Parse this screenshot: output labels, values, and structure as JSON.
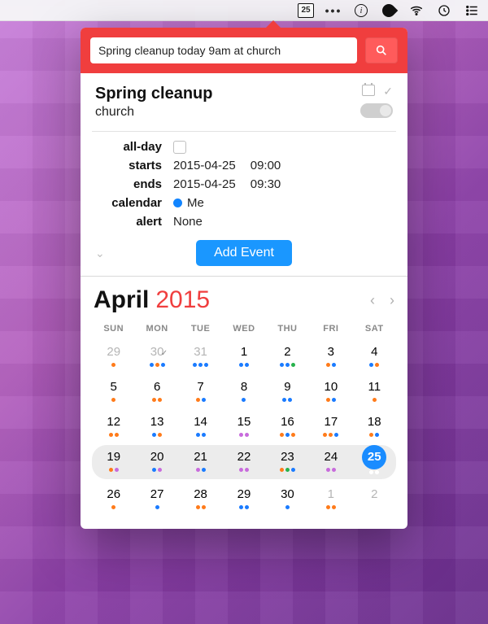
{
  "menubar": {
    "calendar_badge": "25"
  },
  "search": {
    "value": "Spring cleanup today 9am at church"
  },
  "event": {
    "title": "Spring cleanup",
    "location": "church",
    "labels": {
      "allday": "all-day",
      "starts": "starts",
      "ends": "ends",
      "calendar": "calendar",
      "alert": "alert"
    },
    "starts_date": "2015-04-25",
    "starts_time": "09:00",
    "ends_date": "2015-04-25",
    "ends_time": "09:30",
    "calendar_name": "Me",
    "alert_value": "None",
    "add_button": "Add Event"
  },
  "calendar": {
    "month": "April",
    "year": "2015",
    "dow": [
      "SUN",
      "MON",
      "TUE",
      "WED",
      "THU",
      "FRI",
      "SAT"
    ],
    "weeks": [
      {
        "highlight": false,
        "days": [
          {
            "n": "29",
            "grey": true,
            "marks": [
              "o"
            ]
          },
          {
            "n": "30",
            "grey": true,
            "check": true,
            "marks": [
              "b",
              "o",
              "b"
            ]
          },
          {
            "n": "31",
            "grey": true,
            "marks": [
              "b",
              "b",
              "b"
            ]
          },
          {
            "n": "1",
            "marks": [
              "b",
              "b"
            ]
          },
          {
            "n": "2",
            "marks": [
              "b",
              "b",
              "g"
            ]
          },
          {
            "n": "3",
            "marks": [
              "o",
              "b"
            ]
          },
          {
            "n": "4",
            "marks": [
              "b",
              "o"
            ]
          }
        ]
      },
      {
        "highlight": false,
        "days": [
          {
            "n": "5",
            "marks": [
              "o"
            ]
          },
          {
            "n": "6",
            "marks": [
              "o",
              "o"
            ]
          },
          {
            "n": "7",
            "marks": [
              "o",
              "b"
            ]
          },
          {
            "n": "8",
            "marks": [
              "b"
            ]
          },
          {
            "n": "9",
            "marks": [
              "b",
              "b"
            ]
          },
          {
            "n": "10",
            "marks": [
              "o",
              "b"
            ]
          },
          {
            "n": "11",
            "marks": [
              "o"
            ]
          }
        ]
      },
      {
        "highlight": false,
        "days": [
          {
            "n": "12",
            "marks": [
              "o",
              "o"
            ]
          },
          {
            "n": "13",
            "marks": [
              "b",
              "o"
            ]
          },
          {
            "n": "14",
            "marks": [
              "b",
              "b"
            ]
          },
          {
            "n": "15",
            "marks": [
              "p",
              "p"
            ]
          },
          {
            "n": "16",
            "marks": [
              "o",
              "b",
              "o"
            ]
          },
          {
            "n": "17",
            "marks": [
              "o",
              "o",
              "b"
            ]
          },
          {
            "n": "18",
            "marks": [
              "o",
              "b"
            ]
          }
        ]
      },
      {
        "highlight": true,
        "days": [
          {
            "n": "19",
            "marks": [
              "o",
              "p"
            ]
          },
          {
            "n": "20",
            "marks": [
              "b",
              "p"
            ]
          },
          {
            "n": "21",
            "marks": [
              "p",
              "b"
            ]
          },
          {
            "n": "22",
            "marks": [
              "p",
              "p"
            ]
          },
          {
            "n": "23",
            "marks": [
              "o",
              "g",
              "b"
            ]
          },
          {
            "n": "24",
            "marks": [
              "p",
              "p"
            ]
          },
          {
            "n": "25",
            "today": true,
            "marks": [
              "w",
              "w"
            ]
          }
        ]
      },
      {
        "highlight": false,
        "days": [
          {
            "n": "26",
            "marks": [
              "o"
            ]
          },
          {
            "n": "27",
            "marks": [
              "b"
            ]
          },
          {
            "n": "28",
            "marks": [
              "o",
              "o"
            ]
          },
          {
            "n": "29",
            "marks": [
              "b",
              "b"
            ]
          },
          {
            "n": "30",
            "marks": [
              "b"
            ]
          },
          {
            "n": "1",
            "grey": true,
            "marks": [
              "o",
              "o"
            ]
          },
          {
            "n": "2",
            "grey": true,
            "marks": []
          }
        ]
      }
    ]
  }
}
